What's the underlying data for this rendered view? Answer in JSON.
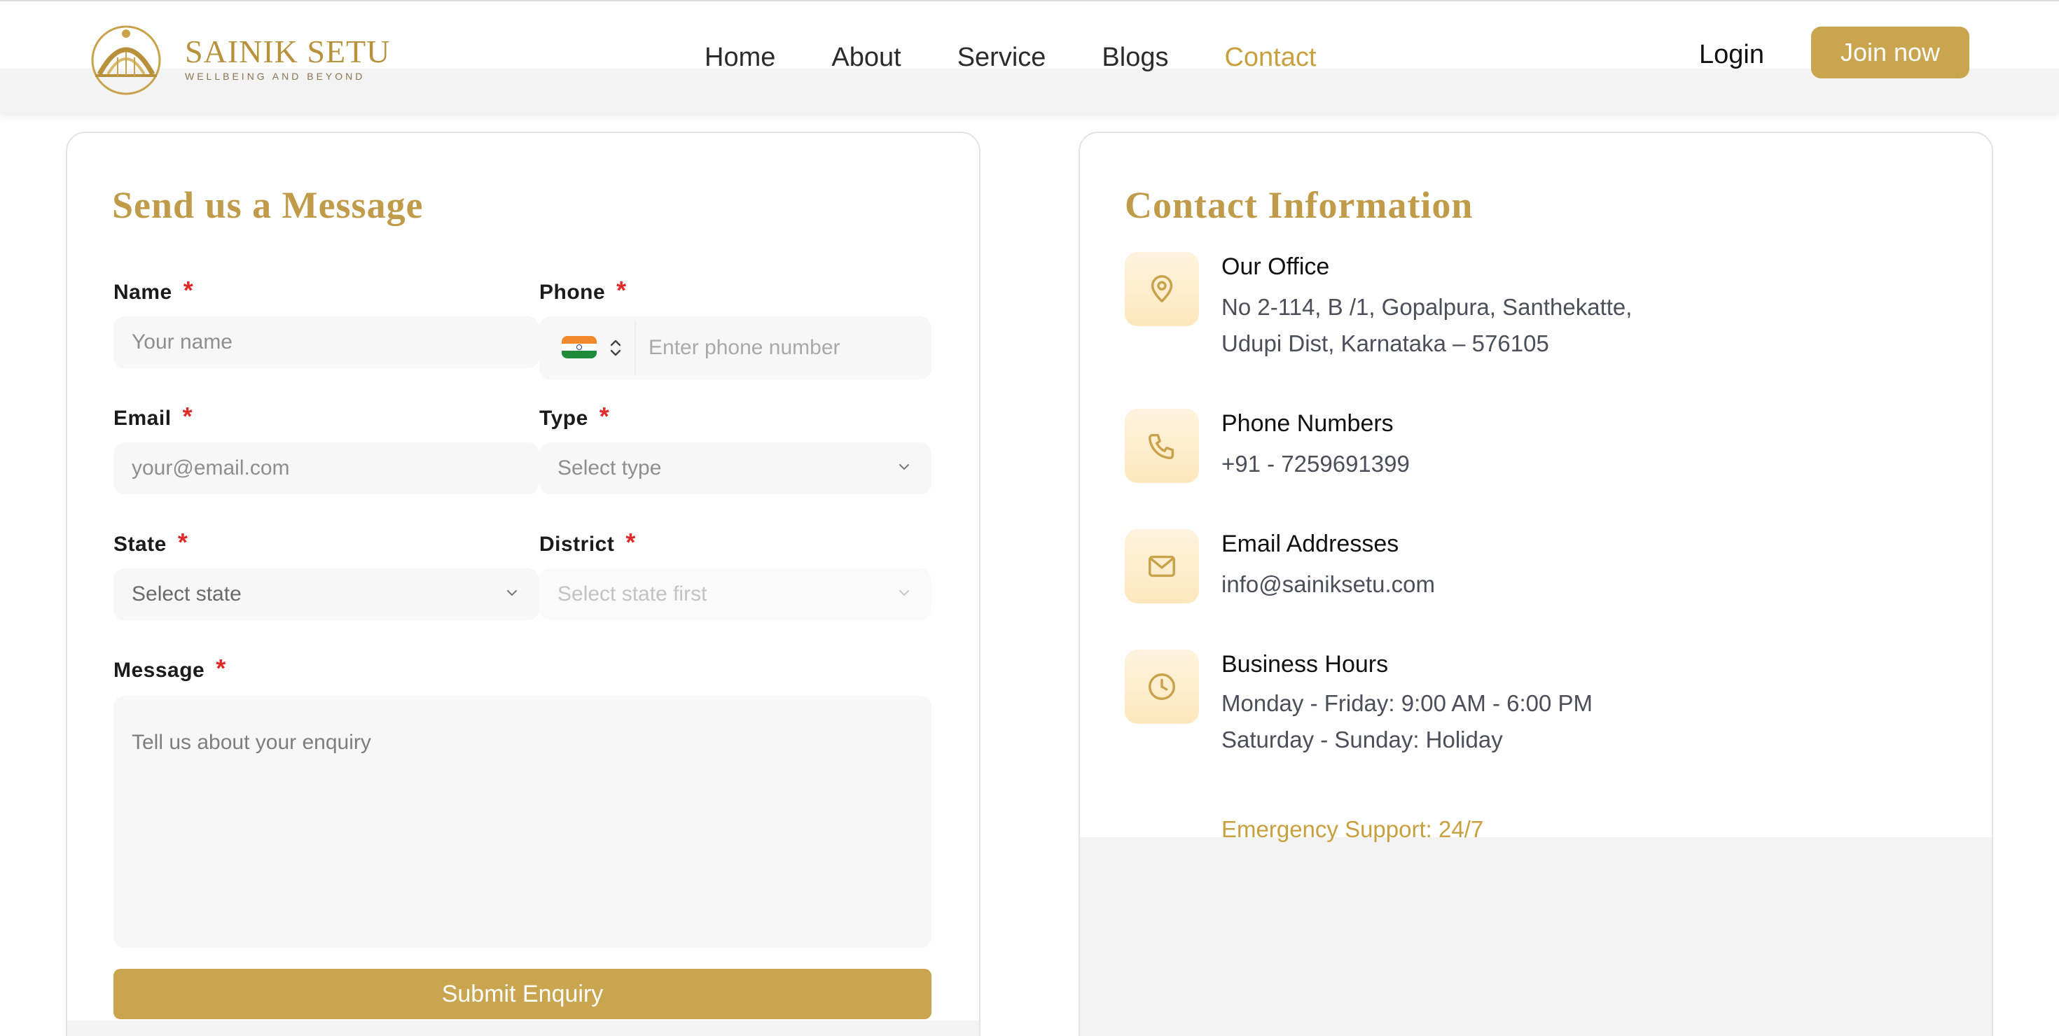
{
  "brand": {
    "name": "SAINIK SETU",
    "tagline": "WELLBEING AND BEYOND",
    "logo_icon": "bridge-arch-icon"
  },
  "nav": {
    "items": [
      {
        "label": "Home"
      },
      {
        "label": "About"
      },
      {
        "label": "Service"
      },
      {
        "label": "Blogs"
      },
      {
        "label": "Contact"
      }
    ],
    "active": "Contact",
    "login_label": "Login",
    "join_label": "Join now"
  },
  "form": {
    "title": "Send us a Message",
    "required_mark": "*",
    "name": {
      "label": "Name",
      "placeholder": "Your name"
    },
    "phone": {
      "label": "Phone",
      "placeholder": "Enter phone number",
      "country_flag": "india-flag-icon"
    },
    "email": {
      "label": "Email",
      "placeholder": "your@email.com"
    },
    "type": {
      "label": "Type",
      "selected": "Select type"
    },
    "state": {
      "label": "State",
      "selected": "Select state"
    },
    "district": {
      "label": "District",
      "selected": "Select state first"
    },
    "message": {
      "label": "Message",
      "placeholder": "Tell us about your enquiry"
    },
    "submit_label": "Submit Enquiry"
  },
  "contact": {
    "title": "Contact Information",
    "office": {
      "icon": "map-pin-icon",
      "title": "Our Office",
      "line1": "No 2-114, B /1, Gopalpura, Santhekatte,",
      "line2": "Udupi Dist, Karnataka – 576105"
    },
    "phone": {
      "icon": "phone-icon",
      "title": "Phone Numbers",
      "line1": "+91 - 7259691399"
    },
    "email": {
      "icon": "mail-icon",
      "title": "Email Addresses",
      "line1": "info@sainiksetu.com"
    },
    "hours": {
      "icon": "clock-icon",
      "title": "Business Hours",
      "line1": "Monday - Friday: 9:00 AM - 6:00 PM",
      "line2": "Saturday - Sunday: Holiday"
    },
    "emergency": "Emergency Support: 24/7"
  },
  "colors": {
    "accent": "#c8a54e",
    "title_gold": "#c09b4a",
    "required": "#e02a2a",
    "icon_bg": "#fde8bd"
  }
}
